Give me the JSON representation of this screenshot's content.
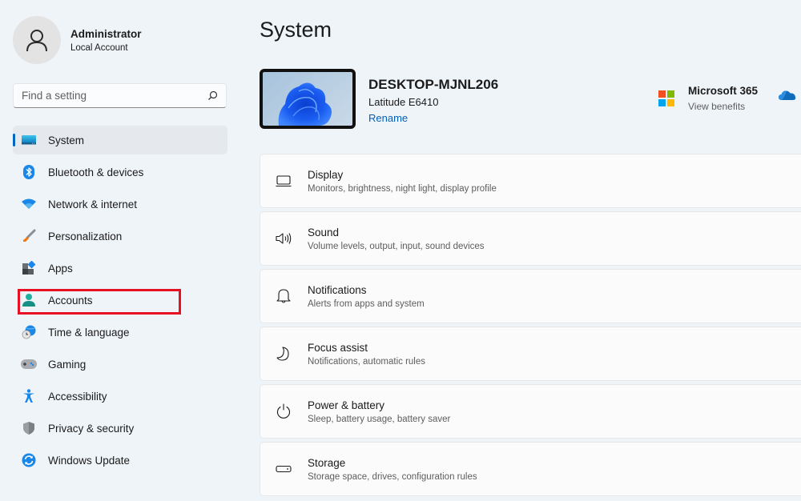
{
  "profile": {
    "name": "Administrator",
    "account_type": "Local Account"
  },
  "search": {
    "placeholder": "Find a setting",
    "value": ""
  },
  "sidebar": {
    "items": [
      {
        "label": "System",
        "icon": "system-icon",
        "active": true
      },
      {
        "label": "Bluetooth & devices",
        "icon": "bluetooth-icon"
      },
      {
        "label": "Network & internet",
        "icon": "wifi-icon"
      },
      {
        "label": "Personalization",
        "icon": "paintbrush-icon"
      },
      {
        "label": "Apps",
        "icon": "apps-icon"
      },
      {
        "label": "Accounts",
        "icon": "account-icon",
        "highlighted": true
      },
      {
        "label": "Time & language",
        "icon": "time-language-icon"
      },
      {
        "label": "Gaming",
        "icon": "gamepad-icon"
      },
      {
        "label": "Accessibility",
        "icon": "accessibility-icon"
      },
      {
        "label": "Privacy & security",
        "icon": "shield-icon"
      },
      {
        "label": "Windows Update",
        "icon": "update-icon"
      }
    ]
  },
  "main": {
    "title": "System",
    "device": {
      "name": "DESKTOP-MJNL206",
      "model": "Latitude E6410",
      "rename_label": "Rename"
    },
    "microsoft365": {
      "title": "Microsoft 365",
      "subtitle": "View benefits"
    },
    "cards": [
      {
        "title": "Display",
        "subtitle": "Monitors, brightness, night light, display profile",
        "icon": "display-icon"
      },
      {
        "title": "Sound",
        "subtitle": "Volume levels, output, input, sound devices",
        "icon": "speaker-icon"
      },
      {
        "title": "Notifications",
        "subtitle": "Alerts from apps and system",
        "icon": "bell-icon"
      },
      {
        "title": "Focus assist",
        "subtitle": "Notifications, automatic rules",
        "icon": "moon-icon"
      },
      {
        "title": "Power & battery",
        "subtitle": "Sleep, battery usage, battery saver",
        "icon": "power-icon"
      },
      {
        "title": "Storage",
        "subtitle": "Storage space, drives, configuration rules",
        "icon": "storage-icon"
      }
    ]
  },
  "colors": {
    "accent": "#0067c0",
    "highlight_border": "#e81123",
    "background": "#eff4f9",
    "link": "#005fb8"
  }
}
